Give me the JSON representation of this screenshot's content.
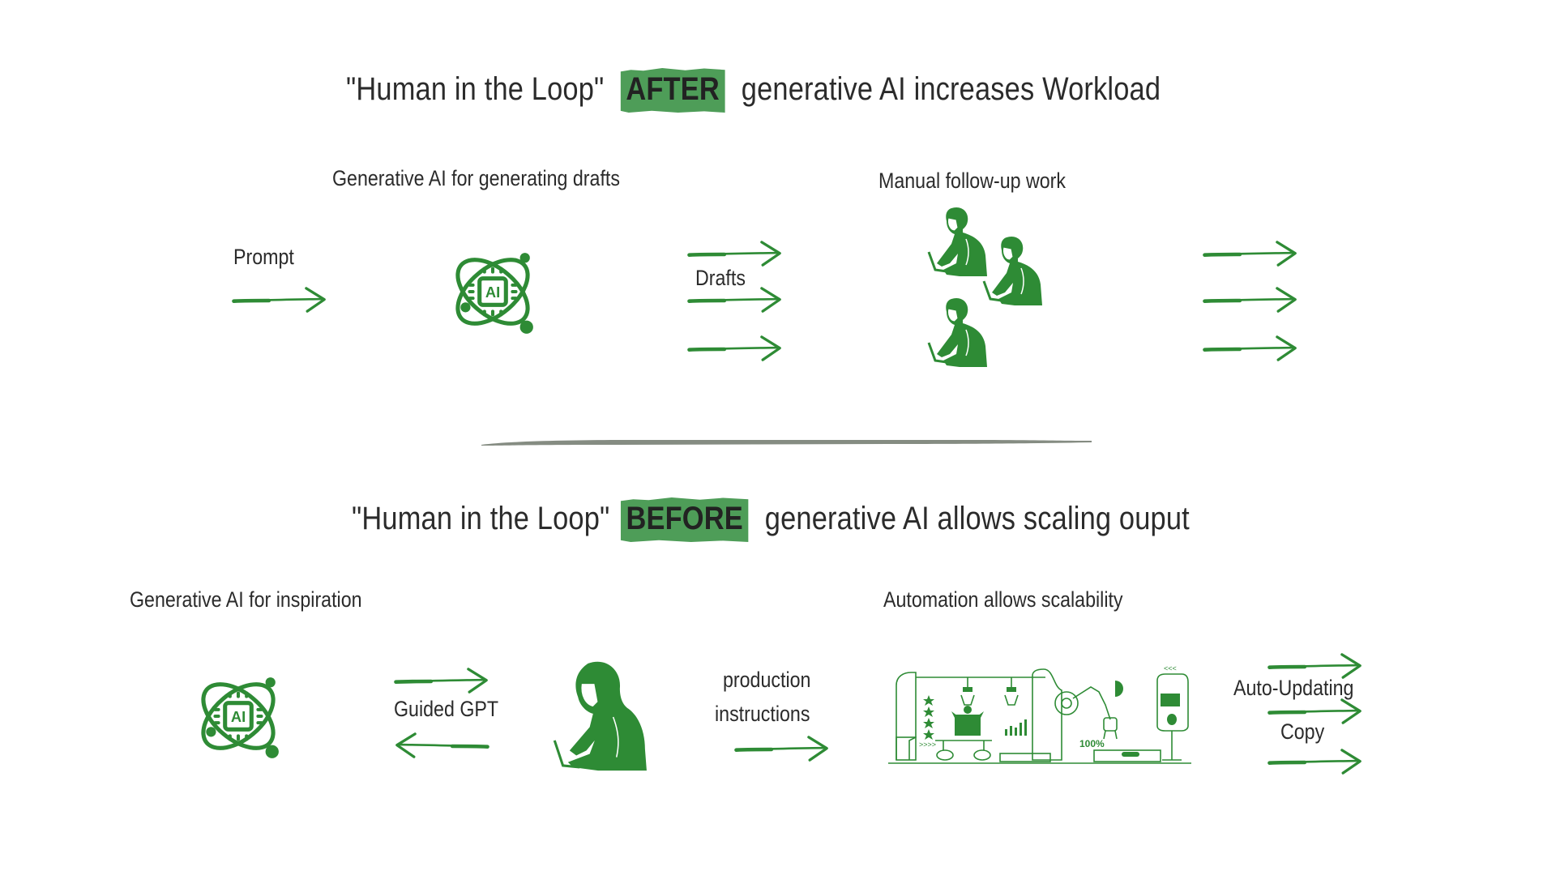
{
  "colors": {
    "accent": "#2e8b35",
    "highlight": "#4e9d58",
    "divider": "#858c82",
    "text": "#2b2b2b"
  },
  "after_section": {
    "title_pre": "\"Human in the Loop\"",
    "title_highlight": "AFTER",
    "title_post": "generative AI increases Workload",
    "labels": {
      "prompt": "Prompt",
      "generative_ai": "Generative AI for generating drafts",
      "drafts": "Drafts",
      "manual_work": "Manual follow-up work"
    },
    "icons": [
      "ai-chip-atom-icon",
      "person-at-laptop-icon",
      "person-at-laptop-icon",
      "person-at-laptop-icon"
    ]
  },
  "before_section": {
    "title_pre": "\"Human in the Loop\"",
    "title_highlight": "BEFORE",
    "title_post": "generative AI allows scaling ouput",
    "labels": {
      "inspiration": "Generative AI for inspiration",
      "guided_gpt": "Guided GPT",
      "production_line1": "production",
      "production_line2": "instructions",
      "automation": "Automation allows scalability",
      "auto_updating_line1": "Auto-Updating",
      "auto_updating_line2": "Copy"
    },
    "factory": {
      "percent_label": "100%"
    },
    "icons": [
      "ai-chip-atom-icon",
      "woman-at-laptop-icon",
      "automation-factory-icon"
    ]
  }
}
